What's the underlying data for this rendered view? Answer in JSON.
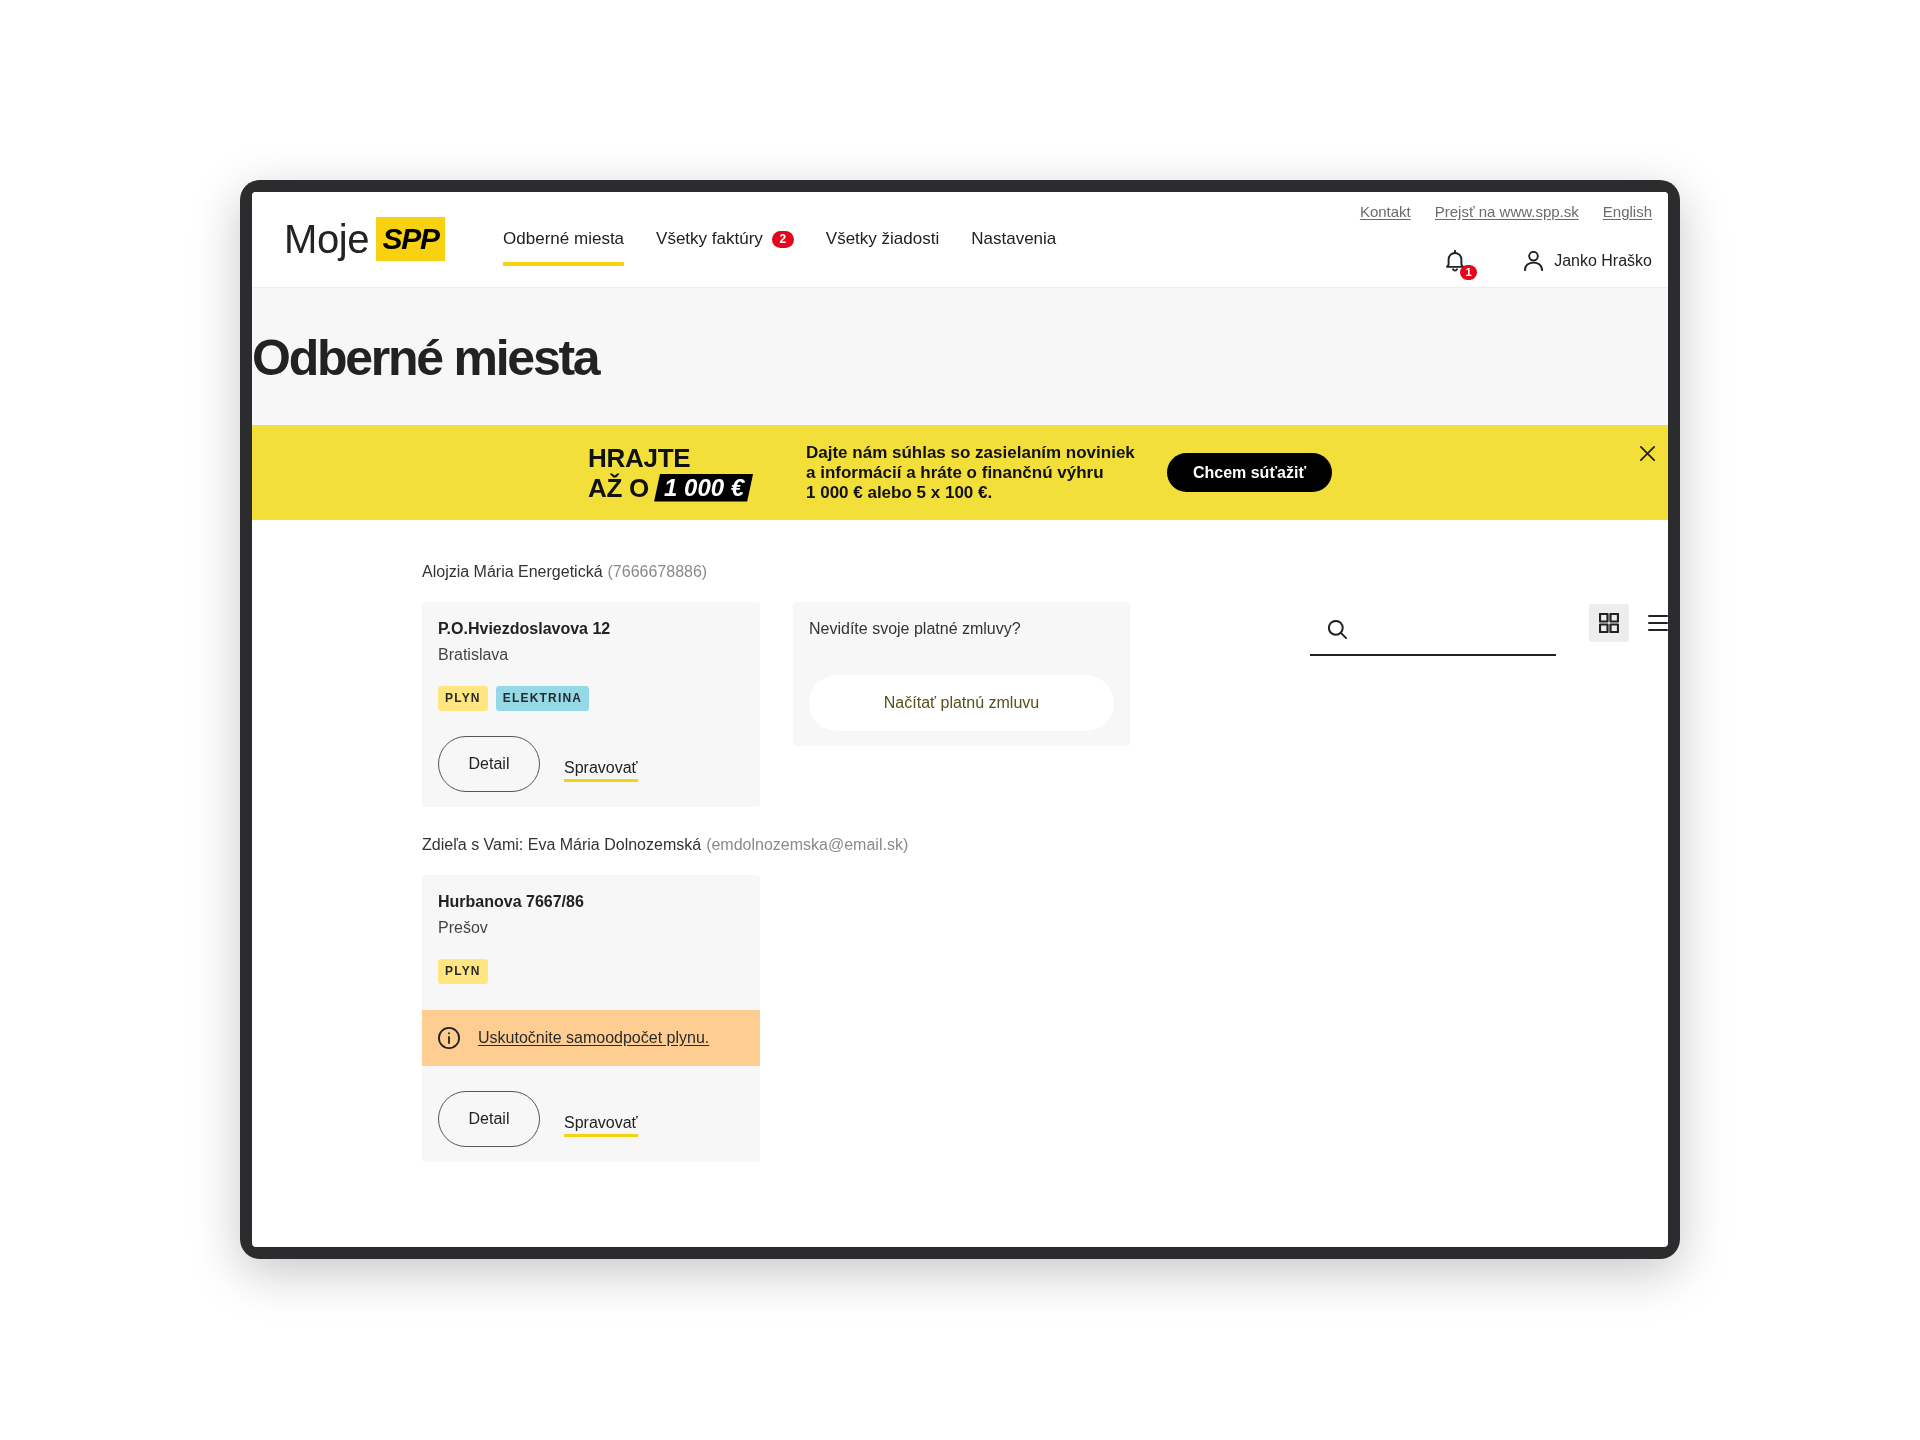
{
  "logo": {
    "word": "Moje",
    "mark": "SPP"
  },
  "nav": [
    {
      "label": "Odberné miesta",
      "selected": true
    },
    {
      "label": "Všetky faktúry",
      "selected": false,
      "badge": "2"
    },
    {
      "label": "Všetky žiadosti",
      "selected": false
    },
    {
      "label": "Nastavenia",
      "selected": false
    }
  ],
  "top_links": [
    "Kontakt",
    "Prejsť na www.spp.sk",
    "English"
  ],
  "notifications": {
    "badge": "1"
  },
  "user": {
    "name": "Janko Hraško"
  },
  "page_title": "Odberné miesta",
  "promo_banner": {
    "headline_lines": [
      "HRAJTE",
      "AŽ O"
    ],
    "amount": "1 000 €",
    "text": "Dajte nám súhlas so zasielaním noviniek a informácií a hráte o finančnú výhru 1 000 € alebo 5 x 100 €.",
    "button": "Chcem súťažiť"
  },
  "view_toggle": [
    {
      "kind": "grid",
      "selected": true
    },
    {
      "kind": "list",
      "selected": false
    }
  ],
  "groups": [
    {
      "owner": "Alojzia Mária Energetická",
      "owner_detail": "(7666678886)",
      "places": [
        {
          "street": "P.O.Hviezdoslavova 12",
          "city": "Bratislava",
          "tags": [
            {
              "label": "PLYN",
              "color": "#ffe680"
            },
            {
              "label": "ELEKTRINA",
              "color": "#95d9e7"
            }
          ],
          "actions": [
            {
              "kind": "outline",
              "label": "Detail"
            },
            {
              "kind": "link",
              "label": "Spravovať"
            }
          ]
        }
      ],
      "prompt": {
        "text": "Nevidíte svoje platné zmluvy?",
        "button": "Načítať platnú zmluvu"
      }
    },
    {
      "owner": "Zdieľa s Vami: Eva Mária Dolnozemská",
      "owner_detail": "(emdolnozemska@email.sk)",
      "places": [
        {
          "street": "Hurbanova 7667/86",
          "city": "Prešov",
          "tags": [
            {
              "label": "PLYN",
              "color": "#ffe680"
            }
          ],
          "notice": {
            "text": "Uskutočnite samoodpočet plynu."
          },
          "actions": [
            {
              "kind": "outline",
              "label": "Detail"
            },
            {
              "kind": "link",
              "label": "Spravovať"
            }
          ]
        }
      ]
    }
  ]
}
